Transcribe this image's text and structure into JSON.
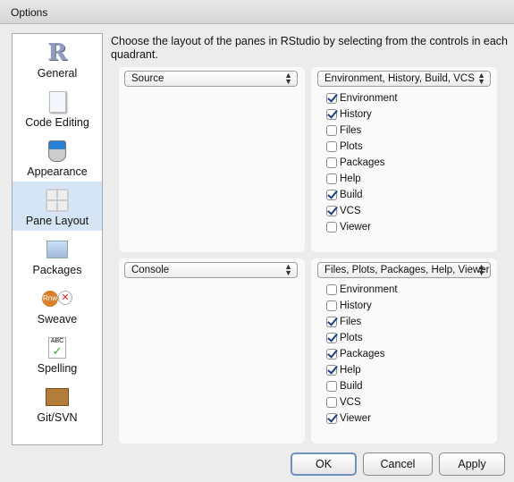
{
  "window": {
    "title": "Options"
  },
  "sidebar": {
    "items": [
      {
        "label": "General",
        "icon": "r-logo-icon",
        "selected": false
      },
      {
        "label": "Code Editing",
        "icon": "document-icon",
        "selected": false
      },
      {
        "label": "Appearance",
        "icon": "paint-bucket-icon",
        "selected": false
      },
      {
        "label": "Pane Layout",
        "icon": "pane-grid-icon",
        "selected": true
      },
      {
        "label": "Packages",
        "icon": "packages-icon",
        "selected": false
      },
      {
        "label": "Sweave",
        "icon": "sweave-pdf-icon",
        "selected": false
      },
      {
        "label": "Spelling",
        "icon": "spelling-check-icon",
        "selected": false
      },
      {
        "label": "Git/SVN",
        "icon": "box-icon",
        "selected": false
      }
    ]
  },
  "main": {
    "instructions": "Choose the layout of the panes in RStudio by selecting from the controls in each quadrant.",
    "top_left": {
      "selected": "Source"
    },
    "bottom_left": {
      "selected": "Console"
    },
    "top_right": {
      "selected": "Environment, History, Build, VCS",
      "items": [
        {
          "label": "Environment",
          "checked": true
        },
        {
          "label": "History",
          "checked": true
        },
        {
          "label": "Files",
          "checked": false
        },
        {
          "label": "Plots",
          "checked": false
        },
        {
          "label": "Packages",
          "checked": false
        },
        {
          "label": "Help",
          "checked": false
        },
        {
          "label": "Build",
          "checked": true
        },
        {
          "label": "VCS",
          "checked": true
        },
        {
          "label": "Viewer",
          "checked": false
        }
      ]
    },
    "bottom_right": {
      "selected": "Files, Plots, Packages, Help, Viewer",
      "items": [
        {
          "label": "Environment",
          "checked": false
        },
        {
          "label": "History",
          "checked": false
        },
        {
          "label": "Files",
          "checked": true
        },
        {
          "label": "Plots",
          "checked": true
        },
        {
          "label": "Packages",
          "checked": true
        },
        {
          "label": "Help",
          "checked": true
        },
        {
          "label": "Build",
          "checked": false
        },
        {
          "label": "VCS",
          "checked": false
        },
        {
          "label": "Viewer",
          "checked": true
        }
      ]
    }
  },
  "buttons": {
    "ok": "OK",
    "cancel": "Cancel",
    "apply": "Apply"
  }
}
